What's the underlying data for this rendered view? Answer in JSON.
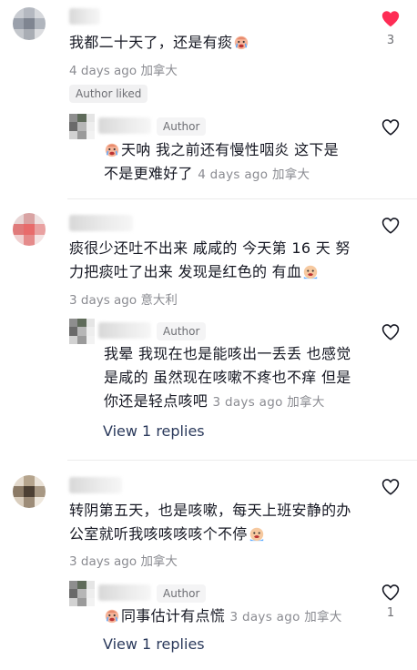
{
  "comments": [
    {
      "text": "我都二十天了，还是有痰",
      "time": "4 days ago",
      "location": "加拿大",
      "likes": "3",
      "liked": true,
      "author_liked_label": "Author liked",
      "reply": {
        "badge": "Author",
        "text_line1": "天呐 我之前还有慢性咽炎 这下是",
        "text_line2": "不是更难好了",
        "time": "4 days ago",
        "location": "加拿大"
      }
    },
    {
      "text_line1": "痰很少还吐不出来 咸咸的 今天第 16 天 努",
      "text_line2": "力把痰吐了出来 发现是红色的 有血",
      "time": "3 days ago",
      "location": "意大利",
      "reply": {
        "badge": "Author",
        "text_line1": "我晕 我现在也是能咳出一丢丢 也感觉",
        "text_line2": "是咸的 虽然现在咳嗽不疼也不痒 但是",
        "text_line3": "你还是轻点咳吧",
        "time": "3 days ago",
        "location": "加拿大"
      },
      "view_replies": "View 1 replies"
    },
    {
      "text_line1": "转阴第五天，也是咳嗽，每天上班安静的办",
      "text_line2": "公室就听我咳咳咳咳个不停",
      "time": "3 days ago",
      "location": "加拿大",
      "reply": {
        "badge": "Author",
        "text": "同事估计有点慌",
        "time": "3 days ago",
        "location": "加拿大",
        "likes": "1"
      },
      "view_replies": "View 1 replies"
    }
  ],
  "colors": {
    "liked_heart": "#fe2c55",
    "text": "#161823",
    "meta": "#8a8b91",
    "link": "#2b3a5c"
  },
  "icons": {
    "like": "heart-outline-icon",
    "liked": "heart-filled-icon",
    "emoji_crying": "crying-emoji-icon"
  }
}
